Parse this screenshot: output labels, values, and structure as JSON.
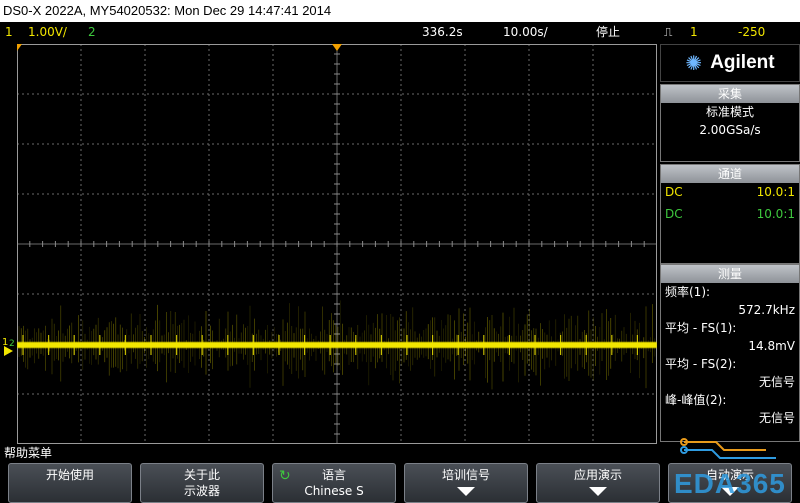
{
  "titlebar": {
    "text": "DS0-X 2022A, MY54020532: Mon Dec 29 14:47:41 2014"
  },
  "status": {
    "ch1_num": "1",
    "ch1_scale": "1.00V/",
    "ch2_num": "2",
    "delay": "336.2s",
    "timebase": "10.00s/",
    "run_state": "停止",
    "trigger_icon": "trigger-edge-icon",
    "trigger_ch": "1",
    "trigger_level": "-250"
  },
  "brand": {
    "name": "Agilent",
    "logo_icon": "spark-icon"
  },
  "acquire": {
    "header": "采集",
    "mode": "标准模式",
    "rate": "2.00GSa/s"
  },
  "channels": {
    "header": "通道",
    "rows": [
      {
        "coupling": "DC",
        "probe": "10.0:1",
        "color": "#f2e600"
      },
      {
        "coupling": "DC",
        "probe": "10.0:1",
        "color": "#3ec83e"
      }
    ]
  },
  "measure": {
    "header": "测量",
    "items": [
      {
        "label": "频率(1):",
        "value": "572.7kHz"
      },
      {
        "label": "平均 - FS(1):",
        "value": "14.8mV"
      },
      {
        "label": "平均 - FS(2):",
        "value": "无信号"
      },
      {
        "label": "峰-峰值(2):",
        "value": "无信号"
      }
    ]
  },
  "help": {
    "label": "帮助菜单"
  },
  "softkeys": [
    {
      "line1": "开始使用",
      "line2": ""
    },
    {
      "line1": "关于此",
      "line2": "示波器"
    },
    {
      "line1": "语言",
      "line2": "Chinese S"
    },
    {
      "line1": "培训信号",
      "line2": ""
    },
    {
      "line1": "应用演示",
      "line2": ""
    },
    {
      "line1": "自动演示",
      "line2": ""
    }
  ],
  "watermark": {
    "text": "EDA365"
  },
  "colors": {
    "ch1": "#f2e600",
    "ch2": "#3ec83e",
    "grid": "#6a6a6a"
  }
}
